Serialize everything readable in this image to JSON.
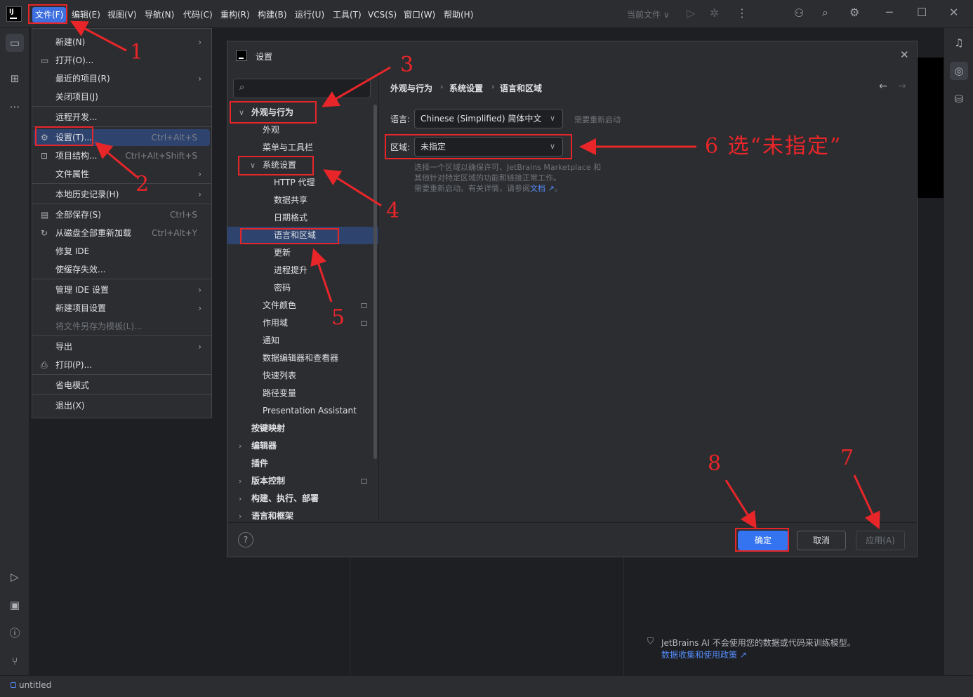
{
  "menubar": {
    "items": [
      "文件(F)",
      "编辑(E)",
      "视图(V)",
      "导航(N)",
      "代码(C)",
      "重构(R)",
      "构建(B)",
      "运行(U)",
      "工具(T)",
      "VCS(S)",
      "窗口(W)",
      "帮助(H)"
    ],
    "current_file_label": "当前文件 ∨"
  },
  "file_menu": {
    "items": [
      {
        "label": "新建(N)",
        "submenu": true
      },
      {
        "label": "打开(O)...",
        "icon": "folder-icon"
      },
      {
        "label": "最近的项目(R)",
        "submenu": true
      },
      {
        "label": "关闭项目(J)"
      },
      {
        "label": "远程开发..."
      },
      {
        "label": "设置(T)...",
        "shortcut": "Ctrl+Alt+S",
        "icon": "gear-icon",
        "selected": true
      },
      {
        "label": "项目结构...",
        "shortcut": "Ctrl+Alt+Shift+S",
        "icon": "project-structure-icon"
      },
      {
        "label": "文件属性",
        "submenu": true
      },
      {
        "label": "本地历史记录(H)",
        "submenu": true
      },
      {
        "label": "全部保存(S)",
        "shortcut": "Ctrl+S",
        "icon": "save-icon"
      },
      {
        "label": "从磁盘全部重新加载",
        "shortcut": "Ctrl+Alt+Y",
        "icon": "reload-icon"
      },
      {
        "label": "修复 IDE"
      },
      {
        "label": "使缓存失效..."
      },
      {
        "label": "管理 IDE 设置",
        "submenu": true
      },
      {
        "label": "新建项目设置",
        "submenu": true
      },
      {
        "label": "将文件另存为模板(L)...",
        "disabled": true
      },
      {
        "label": "导出",
        "submenu": true
      },
      {
        "label": "打印(P)...",
        "icon": "print-icon"
      },
      {
        "label": "省电模式"
      },
      {
        "label": "退出(X)"
      }
    ]
  },
  "settings_dialog": {
    "title": "设置",
    "search_icon": "search-icon",
    "tree": [
      {
        "label": "外观与行为",
        "level": 0,
        "expanded": true,
        "bold": true
      },
      {
        "label": "外观",
        "level": 1
      },
      {
        "label": "菜单与工具栏",
        "level": 1
      },
      {
        "label": "系统设置",
        "level": 1,
        "expanded": true
      },
      {
        "label": "HTTP 代理",
        "level": 2
      },
      {
        "label": "数据共享",
        "level": 2
      },
      {
        "label": "日期格式",
        "level": 2
      },
      {
        "label": "语言和区域",
        "level": 2,
        "selected": true
      },
      {
        "label": "更新",
        "level": 2
      },
      {
        "label": "进程提升",
        "level": 2
      },
      {
        "label": "密码",
        "level": 2
      },
      {
        "label": "文件颜色",
        "level": 1,
        "badge": true
      },
      {
        "label": "作用域",
        "level": 1,
        "badge": true
      },
      {
        "label": "通知",
        "level": 1
      },
      {
        "label": "数据编辑器和查看器",
        "level": 1
      },
      {
        "label": "快速列表",
        "level": 1
      },
      {
        "label": "路径变量",
        "level": 1
      },
      {
        "label": "Presentation Assistant",
        "level": 1
      },
      {
        "label": "按键映射",
        "level": 0,
        "bold": true
      },
      {
        "label": "编辑器",
        "level": 0,
        "collapsed": true,
        "bold": true
      },
      {
        "label": "插件",
        "level": 0,
        "bold": true
      },
      {
        "label": "版本控制",
        "level": 0,
        "collapsed": true,
        "bold": true,
        "badge": true
      },
      {
        "label": "构建、执行、部署",
        "level": 0,
        "collapsed": true,
        "bold": true
      },
      {
        "label": "语言和框架",
        "level": 0,
        "collapsed": true,
        "bold": true
      }
    ],
    "breadcrumb": [
      "外观与行为",
      "系统设置",
      "语言和区域"
    ],
    "language_label": "语言:",
    "language_value": "Chinese (Simplified) 简体中文",
    "language_hint": "需要重新启动",
    "region_label": "区域:",
    "region_value": "未指定",
    "region_hint_line1": "选择一个区域以确保许可、JetBrains Marketplace 和",
    "region_hint_line2": "其他针对特定区域的功能和链接正常工作。",
    "region_hint_line3": "需要重新启动。有关详情，请参阅",
    "region_hint_link": "文档 ↗",
    "region_hint_end": "。",
    "buttons": {
      "ok": "确定",
      "cancel": "取消",
      "apply": "应用(A)",
      "help": "?"
    }
  },
  "ai_notice": {
    "text": "JetBrains AI 不会使用您的数据或代码来训练模型。",
    "link": "数据收集和使用政策 ↗"
  },
  "statusbar": {
    "project": "untitled"
  },
  "annotations": {
    "n1": "1",
    "n2": "2",
    "n3": "3",
    "n4": "4",
    "n5": "5",
    "n6": "6 选“未指定”",
    "n7": "7",
    "n8": "8",
    "color": "#e8262a"
  },
  "colors": {
    "accent": "#3574f0",
    "selection": "#2e436e",
    "background": "#2b2d30"
  }
}
